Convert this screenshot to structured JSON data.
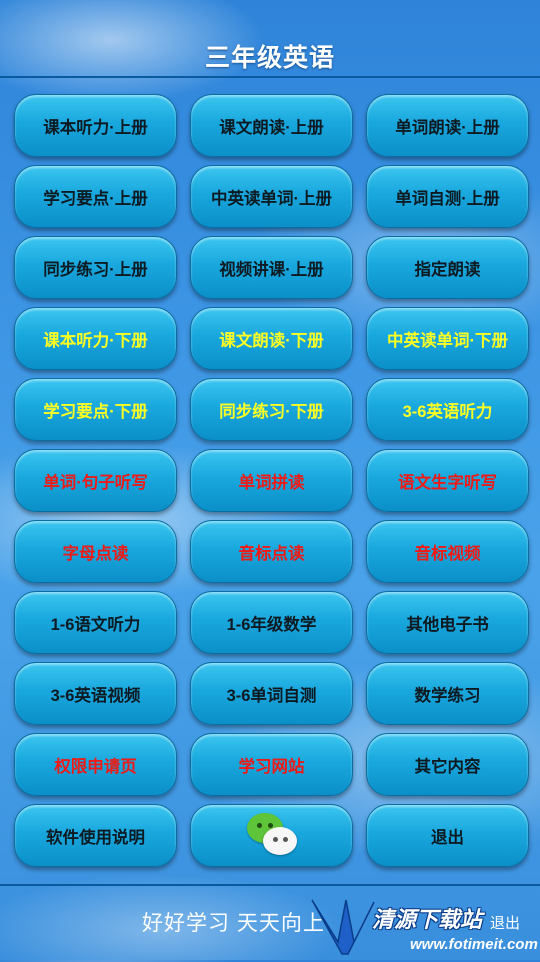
{
  "header": {
    "title": "三年级英语"
  },
  "menu": {
    "b1": "课本听力·上册",
    "b2": "课文朗读·上册",
    "b3": "单词朗读·上册",
    "b4": "学习要点·上册",
    "b5": "中英读单词·上册",
    "b6": "单词自测·上册",
    "b7": "同步练习·上册",
    "b8": "视频讲课·上册",
    "b9": "指定朗读",
    "b10": "课本听力·下册",
    "b11": "课文朗读·下册",
    "b12": "中英读单词·下册",
    "b13": "学习要点·下册",
    "b14": "同步练习·下册",
    "b15": "3-6英语听力",
    "b16": "单词·句子听写",
    "b17": "单词拼读",
    "b18": "语文生字听写",
    "b19": "字母点读",
    "b20": "音标点读",
    "b21": "音标视频",
    "b22": "1-6语文听力",
    "b23": "1-6年级数学",
    "b24": "其他电子书",
    "b25": "3-6英语视频",
    "b26": "3-6单词自测",
    "b27": "数学练习",
    "b28": "权限申请页",
    "b29": "学习网站",
    "b30": "其它内容",
    "b31": "软件使用说明",
    "b32_icon": "wechat-icon",
    "b33": "退出"
  },
  "footer": {
    "slogan": "好好学习  天天向上",
    "exit": "退出"
  },
  "watermark": {
    "brand": "清源下载站",
    "url": "www.fotimeit.com"
  },
  "colors": {
    "default_text": "#0d1a22",
    "yellow_text": "#ffff22",
    "red_text": "#ee1a16",
    "button_blue": "#19a8de"
  }
}
